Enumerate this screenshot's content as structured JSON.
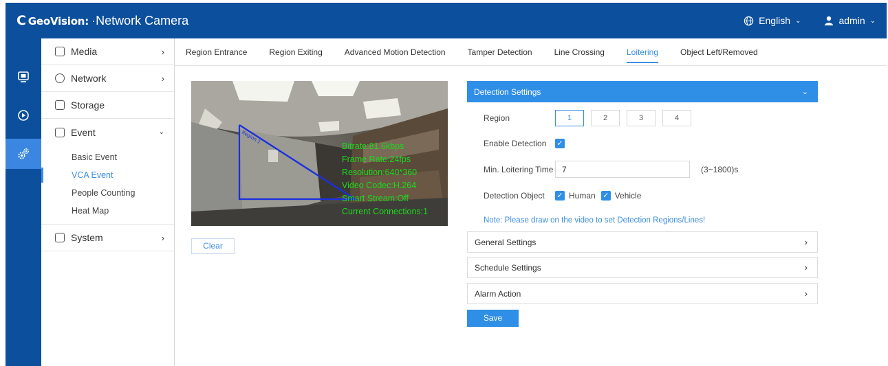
{
  "header": {
    "logo_text": "GeoVision:",
    "title": "Network Camera",
    "language": "English",
    "user": "admin"
  },
  "rail": {
    "icons": [
      "live-view-icon",
      "playback-icon",
      "settings-icon"
    ]
  },
  "sidebar": {
    "items": [
      {
        "label": "Media",
        "icon": "media-icon"
      },
      {
        "label": "Network",
        "icon": "network-icon"
      },
      {
        "label": "Storage",
        "icon": "storage-icon"
      },
      {
        "label": "Event",
        "icon": "event-icon",
        "expanded": true
      },
      {
        "label": "System",
        "icon": "system-icon"
      }
    ],
    "event_sub": [
      {
        "label": "Basic Event"
      },
      {
        "label": "VCA Event",
        "active": true
      },
      {
        "label": "People Counting"
      },
      {
        "label": "Heat Map"
      }
    ]
  },
  "tabs": [
    {
      "label": "Region Entrance"
    },
    {
      "label": "Region Exiting"
    },
    {
      "label": "Advanced Motion Detection"
    },
    {
      "label": "Tamper Detection"
    },
    {
      "label": "Line Crossing"
    },
    {
      "label": "Loitering",
      "active": true
    },
    {
      "label": "Object Left/Removed"
    }
  ],
  "video": {
    "region_label": "Region 1",
    "osd": [
      "Bitrate:81.6kbps",
      "Frame Rate:24fps",
      "Resolution:640*360",
      "Video Codec:H.264",
      "Smart Stream:Off",
      "Current Connections:1"
    ],
    "clear_label": "Clear"
  },
  "detection": {
    "header": "Detection Settings",
    "region_label": "Region",
    "regions": [
      "1",
      "2",
      "3",
      "4"
    ],
    "selected_region": "1",
    "enable_label": "Enable Detection",
    "enable_checked": true,
    "min_time_label": "Min. Loitering Time",
    "min_time_value": "7",
    "min_time_range": "(3~1800)s",
    "object_label": "Detection Object",
    "object_human": "Human",
    "object_vehicle": "Vehicle",
    "note": "Note: Please draw on the video to set Detection Regions/Lines!"
  },
  "sections": {
    "general": "General Settings",
    "schedule": "Schedule Settings",
    "alarm": "Alarm Action"
  },
  "save_label": "Save",
  "colors": {
    "header_bg": "#0c4f9c",
    "accent": "#2f8ee6",
    "osd_text": "#1dd91d",
    "region_line": "#1a2fe0"
  }
}
